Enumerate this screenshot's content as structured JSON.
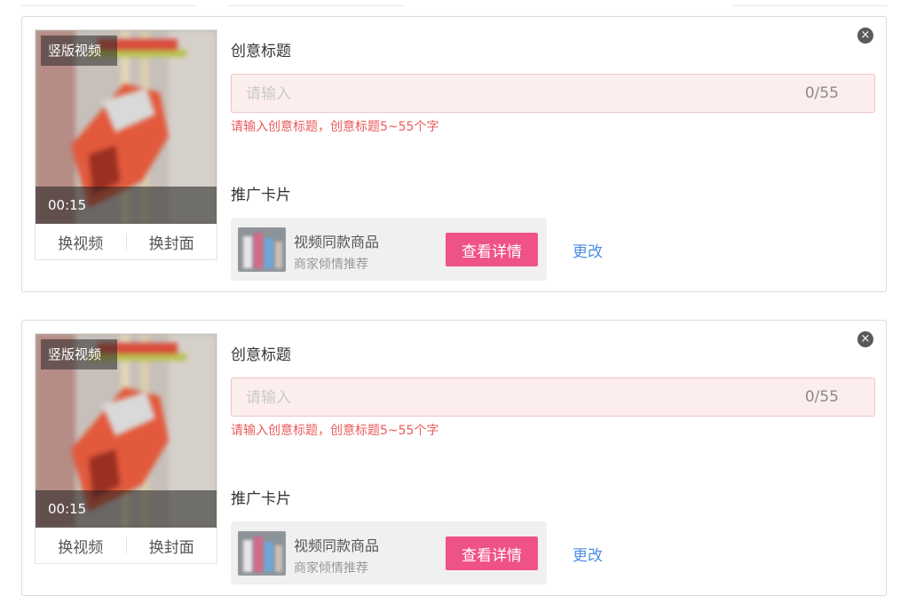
{
  "cards": [
    {
      "video": {
        "tag": "竖版视频",
        "duration": "00:15",
        "replace_video": "换视频",
        "replace_cover": "换封面"
      },
      "title_label": "创意标题",
      "title_input": {
        "placeholder": "请输入",
        "value": "",
        "counter": "0/55"
      },
      "error_text": "请输入创意标题，创意标题5~55个字",
      "promo_label": "推广卡片",
      "promo_card": {
        "title": "视频同款商品",
        "subtitle": "商家倾情推荐",
        "button": "查看详情"
      },
      "change_link": "更改",
      "close_icon": "×"
    },
    {
      "video": {
        "tag": "竖版视频",
        "duration": "00:15",
        "replace_video": "换视频",
        "replace_cover": "换封面"
      },
      "title_label": "创意标题",
      "title_input": {
        "placeholder": "请输入",
        "value": "",
        "counter": "0/55"
      },
      "error_text": "请输入创意标题，创意标题5~55个字",
      "promo_label": "推广卡片",
      "promo_card": {
        "title": "视频同款商品",
        "subtitle": "商家倾情推荐",
        "button": "查看详情"
      },
      "change_link": "更改",
      "close_icon": "×"
    }
  ],
  "colors": {
    "accent_pink": "#ef5286",
    "error_red": "#ea5b5b",
    "link_blue": "#4a90e2",
    "input_error_bg": "#fdeeee"
  }
}
